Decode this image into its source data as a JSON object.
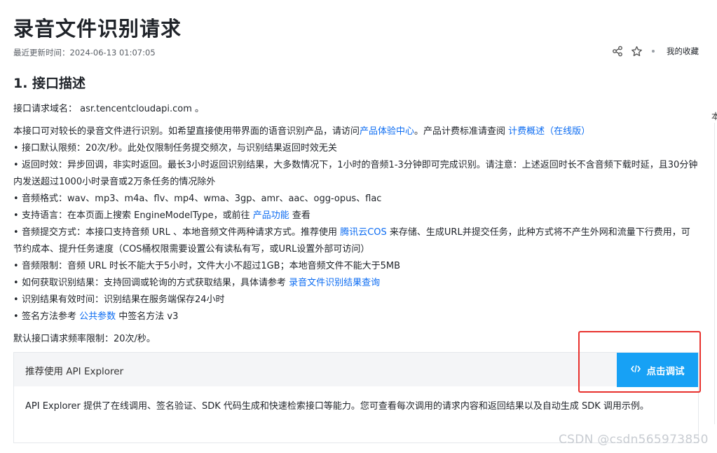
{
  "page": {
    "title": "录音文件识别请求",
    "updated": "最近更新时间：2024-06-13 01:07:05",
    "favorite_label": "我的收藏",
    "edge_char": "本"
  },
  "section": {
    "heading": "1. 接口描述"
  },
  "domain_line": "接口请求域名： asr.tencentcloudapi.com 。",
  "intro": {
    "text_a": "本接口可对较长的录音文件进行识别。如希望直接使用带界面的语音识别产品，请访问",
    "link_a": "产品体验中心",
    "text_b": "。产品计费标准请查阅 ",
    "link_b": "计费概述（在线版）"
  },
  "bullets": {
    "b1": "接口默认限频：20次/秒。此处仅限制任务提交频次，与识别结果返回时效无关",
    "b2": "返回时效：异步回调，非实时返回。最长3小时返回识别结果，大多数情况下，1小时的音频1-3分钟即可完成识别。请注意：上述返回时长不含音频下载时延，且30分钟内发送超过1000小时录音或2万条任务的情况除外",
    "b3": "音频格式：wav、mp3、m4a、flv、mp4、wma、3gp、amr、aac、ogg-opus、flac",
    "b4_a": "支持语言：在本页面上搜索 EngineModelType，或前往 ",
    "b4_link": "产品功能",
    "b4_b": " 查看",
    "b5_a": "音频提交方式：本接口支持音频 URL 、本地音频文件两种请求方式。推荐使用 ",
    "b5_link": "腾讯云COS",
    "b5_b": " 来存储、生成URL并提交任务，此种方式将不产生外网和流量下行费用，可节约成本、提升任务速度（COS桶权限需要设置公有读私有写，或URL设置外部可访问）",
    "b6": "音频限制：音频 URL 时长不能大于5小时，文件大小不超过1GB；本地音频文件不能大于5MB",
    "b7_a": "如何获取识别结果：支持回调或轮询的方式获取结果，具体请参考 ",
    "b7_link": "录音文件识别结果查询",
    "b8": "识别结果有效时间：识别结果在服务端保存24小时",
    "b9_a": "签名方法参考 ",
    "b9_link": "公共参数",
    "b9_b": " 中签名方法 v3"
  },
  "rate_limit": "默认接口请求频率限制：20次/秒。",
  "explorer": {
    "title": "推荐使用 API Explorer",
    "button_label": "点击调试",
    "description": "API Explorer 提供了在线调用、签名验证、SDK 代码生成和快速检索接口等能力。您可查看每次调用的请求内容和返回结果以及自动生成 SDK 调用示例。"
  },
  "watermark": "CSDN @csdn565973850",
  "colors": {
    "link": "#0c6cf2",
    "button": "#17a1f5",
    "highlight_box": "#e8312d"
  },
  "icons": [
    "share-icon",
    "star-icon",
    "code-icon"
  ]
}
